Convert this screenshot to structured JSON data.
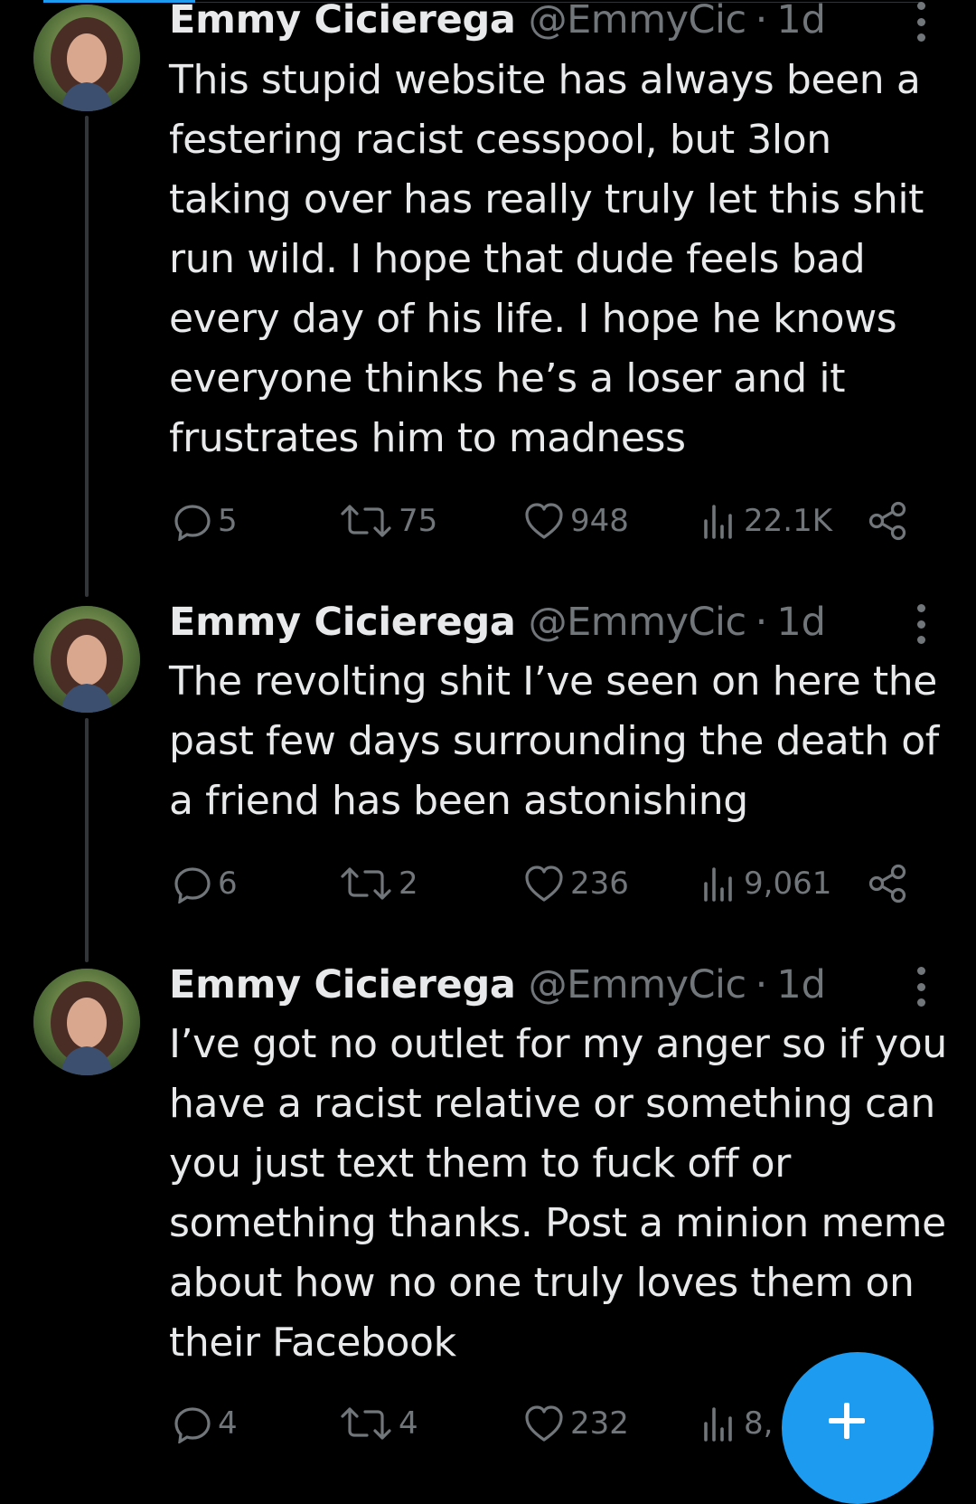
{
  "colors": {
    "background": "#000000",
    "text": "#e7e9ea",
    "muted": "#71767b",
    "accent": "#1d9bf0"
  },
  "tweets": [
    {
      "author": {
        "name": "Emmy Cicierega",
        "handle": "@EmmyCic",
        "sep": "·",
        "time": "1d"
      },
      "text": "This stupid website has always been a festering racist cesspool, but 3lon taking over has really truly let this shit run wild. I hope that dude feels bad every day of his life. I hope he knows everyone thinks he’s a loser and it frustrates him to madness",
      "stats": {
        "replies": "5",
        "reposts": "75",
        "likes": "948",
        "views": "22.1K"
      }
    },
    {
      "author": {
        "name": "Emmy Cicierega",
        "handle": "@EmmyCic",
        "sep": "·",
        "time": "1d"
      },
      "text": "The revolting shit I’ve seen on here the past few days surrounding the death of a friend has been astonishing",
      "stats": {
        "replies": "6",
        "reposts": "2",
        "likes": "236",
        "views": "9,061"
      }
    },
    {
      "author": {
        "name": "Emmy Cicierega",
        "handle": "@EmmyCic",
        "sep": "·",
        "time": "1d"
      },
      "text": "I’ve got no outlet for my anger so if you have a racist relative or something can you just text them to fuck off or something thanks. Post a minion meme about how no one truly loves them on their Facebook",
      "stats": {
        "replies": "4",
        "reposts": "4",
        "likes": "232",
        "views": "8,"
      }
    }
  ],
  "icons": {
    "reply": "reply-icon",
    "repost": "repost-icon",
    "like": "heart-icon",
    "views": "views-icon",
    "share": "share-icon",
    "more": "more-icon",
    "compose": "plus-icon"
  }
}
